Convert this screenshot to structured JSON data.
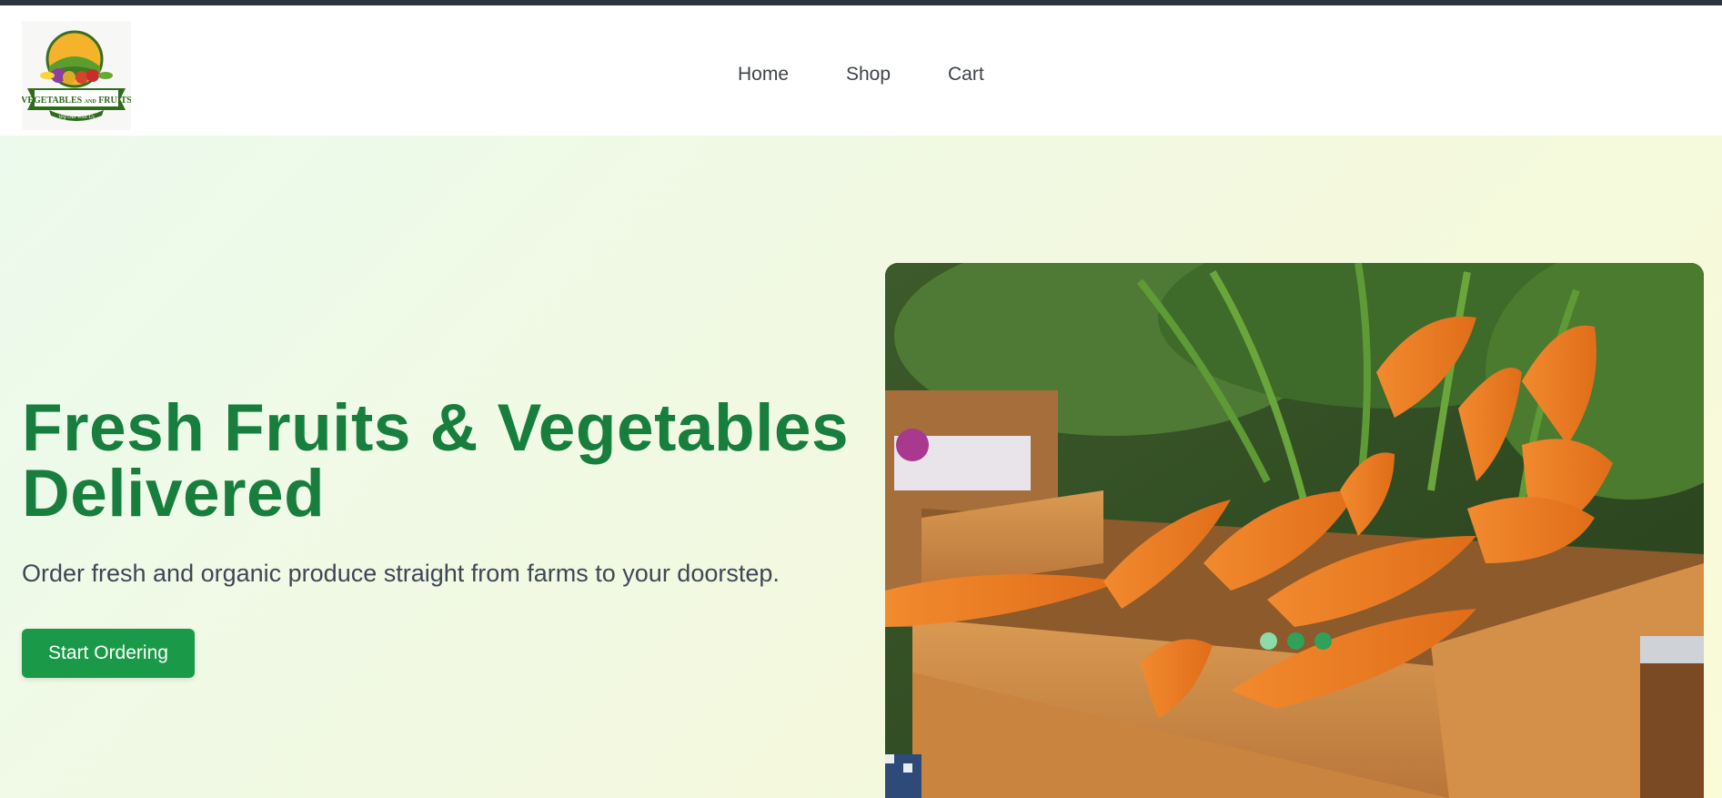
{
  "brand": {
    "logo_text_top": "VEGETABLES",
    "logo_text_and": "AND",
    "logo_text_fruits": "FRUITS",
    "logo_tagline": "Veg Out With Us"
  },
  "nav": {
    "items": [
      {
        "label": "Home"
      },
      {
        "label": "Shop"
      },
      {
        "label": "Cart"
      }
    ]
  },
  "hero": {
    "title_line1": "Fresh Fruits & Vegetables",
    "title_line2": "Delivered",
    "subtitle": "Order fresh and organic produce straight from farms to your doorstep.",
    "cta_label": "Start Ordering",
    "carousel": {
      "slides": 3,
      "active_index": 0
    }
  },
  "colors": {
    "topbar": "#2d3440",
    "brand_green": "#177e3d",
    "button_green": "#1a9a48",
    "dot_active": "#8ddbaa",
    "dot_inactive": "#2fa15a"
  }
}
